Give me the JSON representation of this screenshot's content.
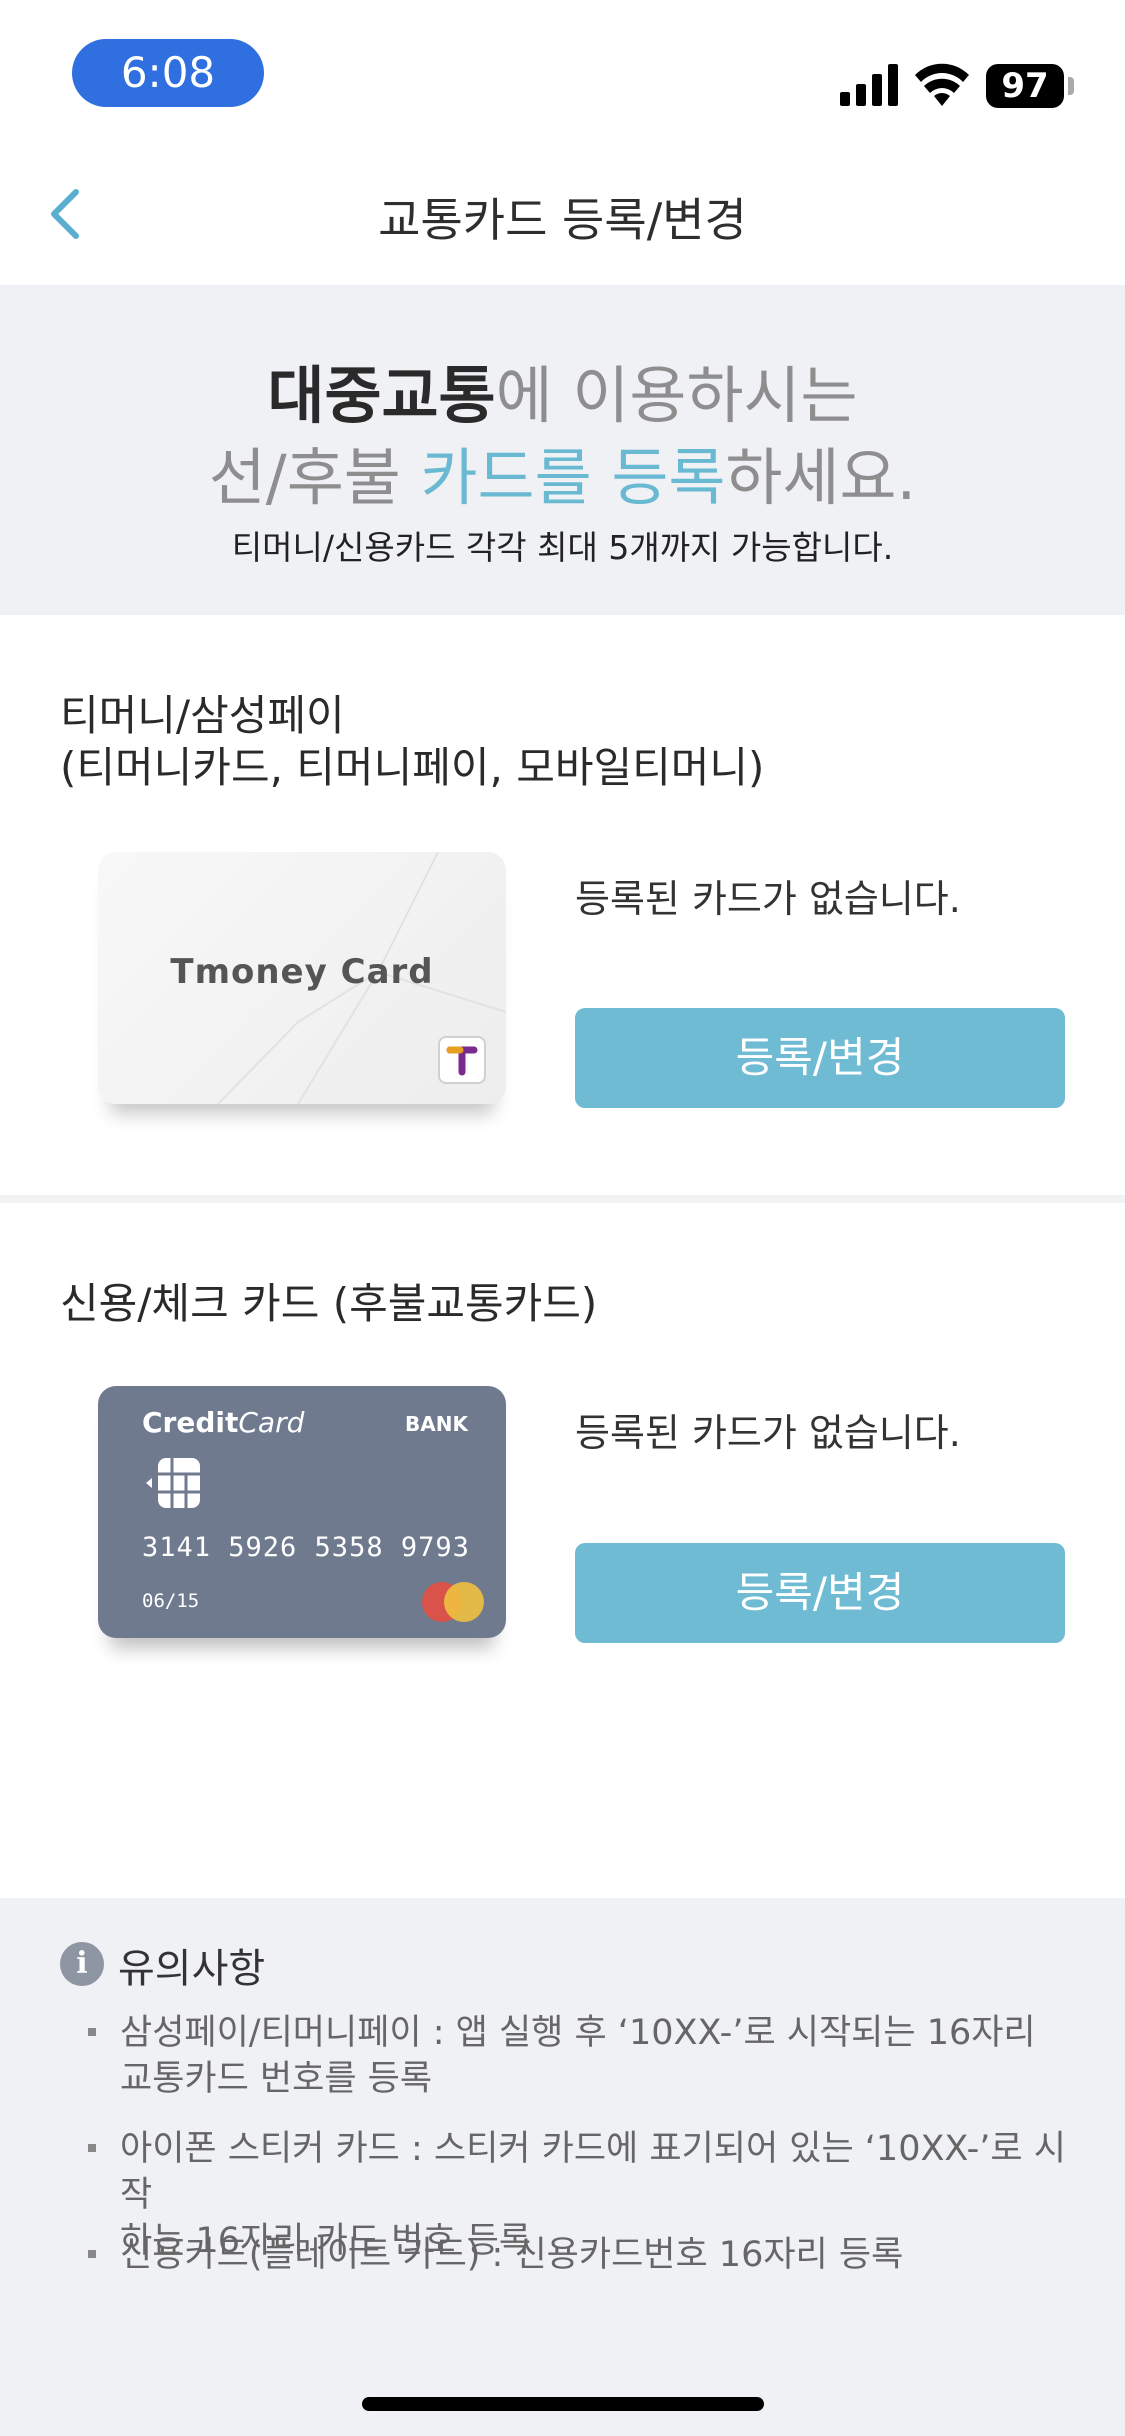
{
  "status_bar": {
    "time": "6:08",
    "battery": "97"
  },
  "nav": {
    "title": "교통카드 등록/변경"
  },
  "hero": {
    "line1_dark": "대중교통",
    "line1_rest": "에 이용하시는",
    "line2_a": "선/후불 ",
    "line2_blue": "카드를 등록",
    "line2_b": "하세요.",
    "subtitle": "티머니/신용카드 각각 최대 5개까지 가능합니다."
  },
  "tmoney_section": {
    "title_line1": "티머니/삼성페이",
    "title_line2": "(티머니카드, 티머니페이, 모바일티머니)",
    "card_label": "Tmoney Card",
    "status": "등록된 카드가 없습니다.",
    "button": "등록/변경"
  },
  "credit_section": {
    "title": "신용/체크 카드 (후불교통카드)",
    "card_brand_bold": "Credit",
    "card_brand_italic": "Card",
    "card_bank": "BANK",
    "card_number": "3141 5926 5358 9793",
    "card_expiry": "06/15",
    "status": "등록된 카드가 없습니다.",
    "button": "등록/변경"
  },
  "notes": {
    "title": "유의사항",
    "items": [
      {
        "line1": "삼성페이/티머니페이 : 앱 실행 후 ‘10XX-’로 시작되는 16자리",
        "line2": "교통카드 번호를 등록"
      },
      {
        "line1": "아이폰 스티커 카드 : 스티커 카드에 표기되어 있는 ‘10XX-’로 시작",
        "line2": "하는 16자리 카드 번호 등록"
      },
      {
        "line1": "신용카드(플레이트 카드) : 신용카드번호 16자리 등록",
        "line2": ""
      }
    ]
  },
  "colors": {
    "accent": "#6ebbd3",
    "time_pill": "#2f6fe0",
    "hero_bg": "#eff1f5"
  }
}
